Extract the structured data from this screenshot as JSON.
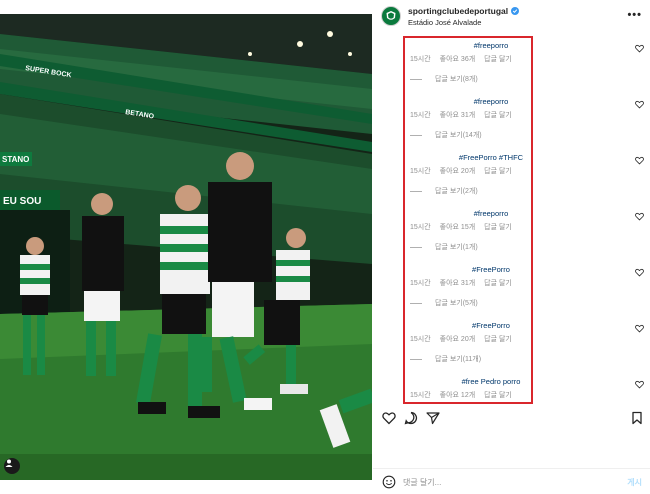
{
  "post": {
    "username": "sportingclubedeportugal",
    "location": "Estádio José Alvalade",
    "more_label": "•••"
  },
  "comments": [
    {
      "text": "#freeporro",
      "time": "15시간",
      "likes": "좋아요 36개",
      "reply": "답글 달기",
      "view_replies": "답글 보기(8개)"
    },
    {
      "text": "#freeporro",
      "time": "15시간",
      "likes": "좋아요 31개",
      "reply": "답글 달기",
      "view_replies": "답글 보기(14개)"
    },
    {
      "text": "#FreePorro #THFC",
      "time": "15시간",
      "likes": "좋아요 20개",
      "reply": "답글 달기",
      "view_replies": "답글 보기(2개)"
    },
    {
      "text": "#freeporro",
      "time": "15시간",
      "likes": "좋아요 15개",
      "reply": "답글 달기",
      "view_replies": "답글 보기(1개)"
    },
    {
      "text": "#FreePorro",
      "time": "15시간",
      "likes": "좋아요 31개",
      "reply": "답글 달기",
      "view_replies": "답글 보기(5개)"
    },
    {
      "text": "#FreePorro",
      "time": "15시간",
      "likes": "좋아요 20개",
      "reply": "답글 달기",
      "view_replies": "답글 보기(11개)"
    },
    {
      "text": "#free Pedro porro",
      "time": "15시간",
      "likes": "좋아요 12개",
      "reply": "답글 달기",
      "view_replies": ""
    }
  ],
  "add_comment": {
    "placeholder": "댓글 달기...",
    "post_label": "게시"
  },
  "photo": {
    "banner_1": "SUPER BOCK",
    "banner_2": "BETANO",
    "banner_3": "EU SOU",
    "banner_4": "STANO"
  },
  "colors": {
    "sporting_green": "#0a7a3d",
    "highlight_red": "#d9262c",
    "link_blue": "#00376b"
  }
}
